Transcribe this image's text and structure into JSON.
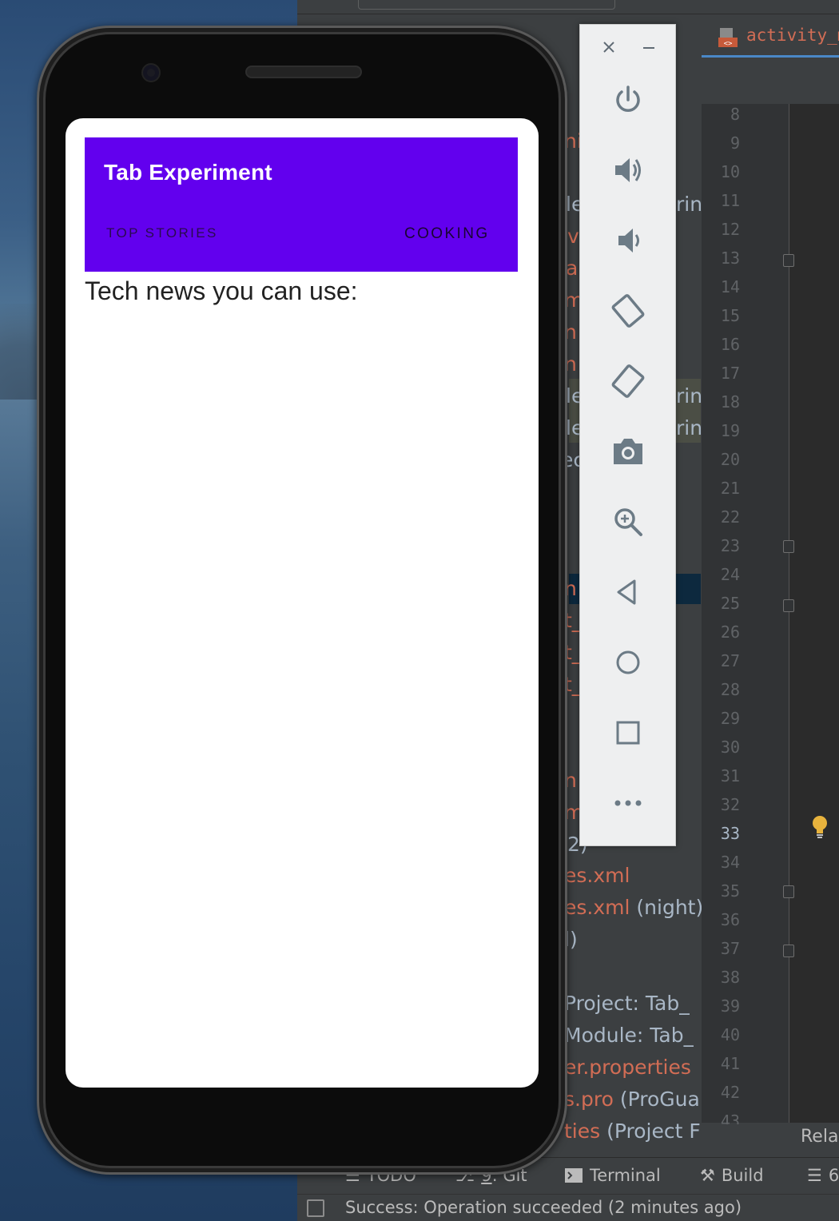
{
  "app": {
    "title": "Tab Experiment",
    "tabs": [
      {
        "label": "TOP STORIES"
      },
      {
        "label": "COOKING"
      }
    ],
    "content_text": "Tech news you can use:",
    "colors": {
      "app_bar": "#6200ee",
      "screen_bg": "#ffffff"
    }
  },
  "emulator_toolbar": {
    "close_icon": "close-icon",
    "minimize_icon": "minimize-icon",
    "buttons": [
      "power-icon",
      "volume-up-icon",
      "volume-down-icon",
      "rotate-left-icon",
      "rotate-right-icon",
      "camera-icon",
      "zoom-icon",
      "back-icon",
      "home-icon",
      "overview-icon",
      "more-icon"
    ]
  },
  "ide": {
    "editor_tab": "activity_ma",
    "line_numbers": [
      "8",
      "9",
      "10",
      "11",
      "12",
      "13",
      "14",
      "15",
      "16",
      "17",
      "18",
      "19",
      "20",
      "21",
      "22",
      "23",
      "24",
      "25",
      "26",
      "27",
      "28",
      "29",
      "30",
      "31",
      "32",
      "33",
      "34",
      "35",
      "36",
      "37",
      "38",
      "39",
      "40",
      "41",
      "42",
      "43"
    ],
    "active_line": "33",
    "project_tree": [
      {
        "text": "ni",
        "cls": "c-red"
      },
      {
        "text": "le",
        "cls": "c-gray"
      },
      {
        "text": "rin",
        "cls": "c-gray"
      },
      {
        "text": "v",
        "cls": "c-red"
      },
      {
        "text": "a",
        "cls": "c-red"
      },
      {
        "text": "m",
        "cls": "c-red"
      },
      {
        "text": "n",
        "cls": "c-red"
      },
      {
        "text": "n",
        "cls": "c-red"
      },
      {
        "text": "le",
        "cls": "c-gray"
      },
      {
        "text": "rin",
        "cls": "c-gray"
      },
      {
        "text": "le",
        "cls": "c-gray"
      },
      {
        "text": "rin",
        "cls": "c-gray"
      },
      {
        "text": "ec",
        "cls": "c-gray"
      },
      {
        "text": "n",
        "cls": "c-red"
      },
      {
        "text": "t_",
        "cls": "c-red"
      },
      {
        "text": "t_",
        "cls": "c-red"
      },
      {
        "text": "t_",
        "cls": "c-red"
      },
      {
        "text": "n",
        "cls": "c-red"
      },
      {
        "text": "m",
        "cls": "c-red"
      },
      {
        "text": "2)",
        "cls": "c-gray"
      },
      {
        "text": "es.xml",
        "cls": "c-red"
      },
      {
        "text": "es.xml",
        "cls": "c-red"
      },
      {
        "text": " (night)",
        "cls": "c-gray"
      },
      {
        "text": "l)",
        "cls": "c-gray"
      },
      {
        "text": "Project: Tab_",
        "cls": "c-gray"
      },
      {
        "text": "Module: Tab_",
        "cls": "c-gray"
      },
      {
        "text": "er.properties",
        "cls": "c-red"
      },
      {
        "text": "s.pro",
        "cls": "c-red"
      },
      {
        "text": " (ProGua",
        "cls": "c-gray"
      },
      {
        "text": "ties",
        "cls": "c-red"
      },
      {
        "text": " (Project F",
        "cls": "c-gray"
      }
    ],
    "right_panel_label": "Rela",
    "bottom_tools": {
      "todo": "TODO",
      "git_num": "9",
      "git": ": Git",
      "terminal": "Terminal",
      "build": "Build",
      "extra": "6"
    },
    "status_message": "Success: Operation succeeded (2 minutes ago)"
  }
}
